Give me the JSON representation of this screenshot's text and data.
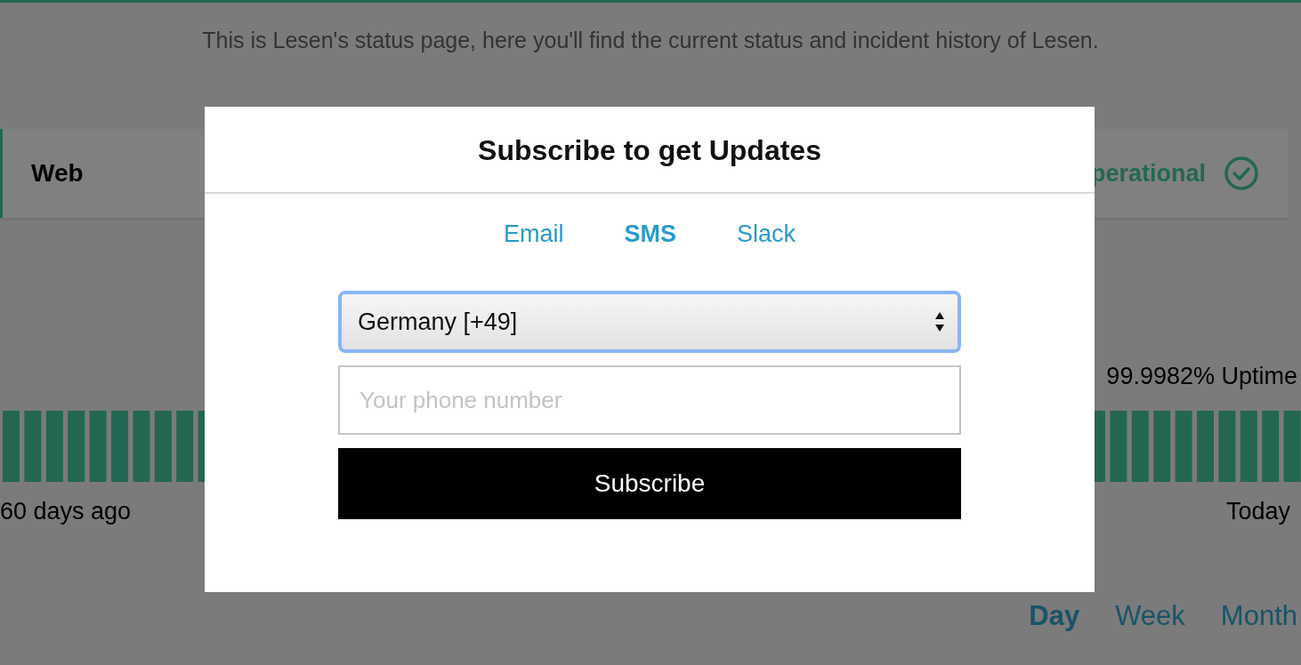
{
  "description": "This is Lesen's status page, here you'll find the current status and incident history of Lesen.",
  "component": {
    "name": "Web",
    "status": "perational"
  },
  "uptime": {
    "reading": "99.9982% Uptime",
    "start_label": "60 days ago",
    "end_label": "Today"
  },
  "ranges": [
    {
      "label": "Day",
      "selected": true
    },
    {
      "label": "Week",
      "selected": false
    },
    {
      "label": "Month",
      "selected": false
    }
  ],
  "modal": {
    "title": "Subscribe to get Updates",
    "tabs": [
      {
        "label": "Email",
        "selected": false
      },
      {
        "label": "SMS",
        "selected": true
      },
      {
        "label": "Slack",
        "selected": false
      }
    ],
    "country": "Germany [+49]",
    "phone": {
      "placeholder": "Your phone number"
    },
    "button": "Subscribe"
  }
}
